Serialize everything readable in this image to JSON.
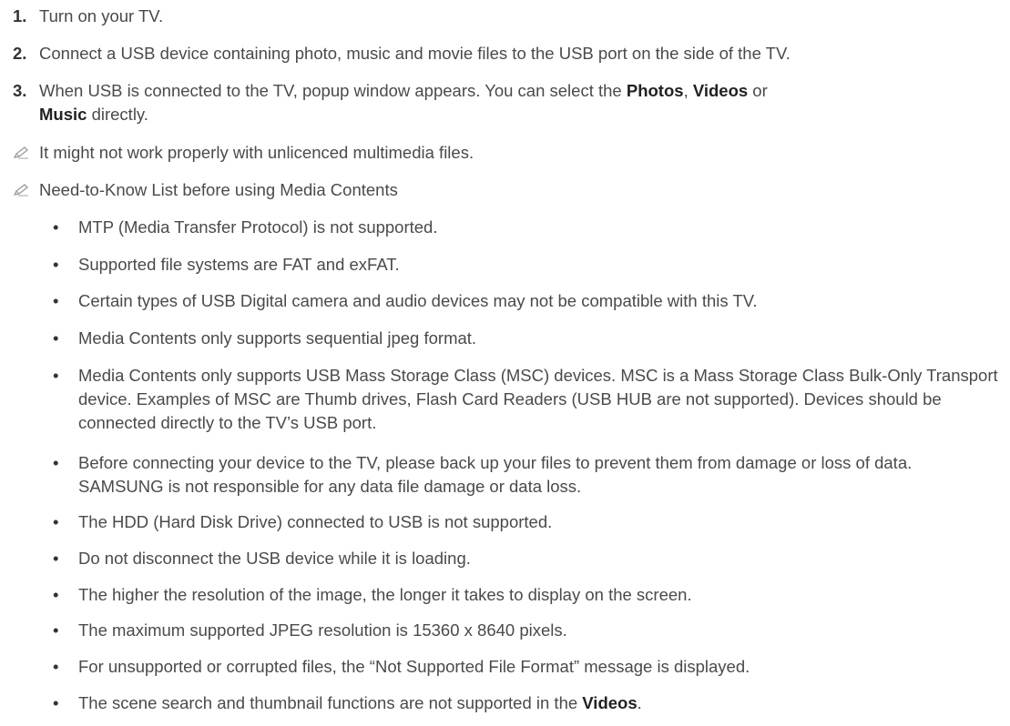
{
  "steps": [
    {
      "num": "1.",
      "text": "Turn on your TV."
    },
    {
      "num": "2.",
      "text": "Connect a USB device containing photo, music and movie files to the USB port on the side of the TV."
    },
    {
      "num": "3.",
      "text_a": "When USB is connected to the TV, popup window appears. You can select the ",
      "b1": "Photos",
      "text_b": ", ",
      "b2": "Videos",
      "text_c": " or ",
      "b3": "Music",
      "text_d": " directly."
    }
  ],
  "notes": [
    {
      "icon": "pencil-note-icon",
      "text": "It might not work properly with unlicenced multimedia files."
    },
    {
      "icon": "pencil-note-icon",
      "text": "Need-to-Know List before using Media Contents"
    }
  ],
  "bullets": [
    {
      "text": "MTP (Media Transfer Protocol) is not supported."
    },
    {
      "text": "Supported file systems are FAT and exFAT."
    },
    {
      "text": "Certain types of USB Digital camera and audio devices may not be compatible with this TV."
    },
    {
      "text": "Media Contents only supports sequential jpeg format."
    },
    {
      "text": "Media Contents only supports USB Mass Storage Class (MSC) devices. MSC is a Mass Storage Class Bulk-Only Transport device. Examples of MSC are Thumb drives, Flash Card Readers (USB HUB are not supported). Devices should be connected directly to the TV’s USB port."
    },
    {
      "text": "Before connecting your device to the TV, please back up your files to prevent them from damage or loss of data. SAMSUNG is not responsible for any data file damage or data loss."
    },
    {
      "text": "The HDD (Hard Disk Drive) connected to USB is not supported."
    },
    {
      "text": "Do not disconnect the USB device while it is loading."
    },
    {
      "text": "The higher the resolution of the image, the longer it takes to display on the screen."
    },
    {
      "text": "The maximum supported JPEG resolution is 15360 x 8640 pixels."
    },
    {
      "text": "For unsupported or corrupted files, the “Not Supported File Format” message is displayed."
    },
    {
      "text_a": "The scene search and thumbnail functions are not supported in the ",
      "b": "Videos",
      "text_b": "."
    }
  ],
  "bullet_char": "•",
  "colors": {
    "text": "#4a4a4a",
    "bold": "#222222",
    "icon": "#9a9a9a",
    "background": "#ffffff"
  }
}
